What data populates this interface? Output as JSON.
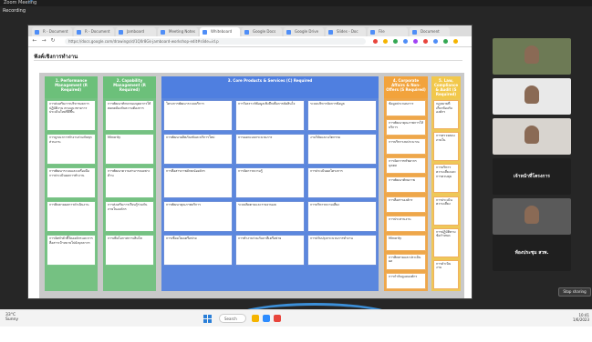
{
  "zoom": {
    "window_title": "Zoom Meeting",
    "subtitle": "Recording",
    "stop_sharing": "Stop sharing"
  },
  "browser": {
    "tabs": [
      "R - Document",
      "R - Document",
      "Jamboard",
      "Meeting Notes",
      "Whiteboard",
      "Google Docs",
      "Google Drive",
      "Slides - Doc",
      "File",
      "Document"
    ],
    "url": "https://docs.google.com/drawings/d/1Q0r8Gk-jamboard-workshop-edit#slide=id.p",
    "nav": [
      "←",
      "→",
      "↻"
    ]
  },
  "page": {
    "title": "ฟังค์เชิงการทำงาน"
  },
  "board": {
    "columns": [
      {
        "head": "1. Performance Management (R Required)",
        "color": "#6cc07a",
        "cards": [
          "การส่งเสริมการบริหารผลการปฏิบัติงาน ตามแนวทางการประเมินใหม่ที่ดีขึ้น",
          "การบูรณาการทำงานร่วมกันทุกส่วนงาน",
          "การพัฒนาระบบและเครื่องมือการประเมินผลการทำงาน",
          "การติดตามผลการดำเนินงาน",
          "การจัดทำตัวชี้วัดองค์กรและการสื่อสารเป้าหมายไปยังบุคลากร"
        ]
      },
      {
        "head": "2. Capability Management (R Required)",
        "color": "#6cc07a",
        "cards": [
          "การพัฒนาทักษะของบุคลากรให้สอดคล้องกับความต้องการ",
          "Minority",
          "การพัฒนาความสามารถเฉพาะด้าน",
          "การส่งเสริมการเรียนรู้ร่วมกันภายในองค์กร",
          "การเพิ่มโอกาสการเติบโต"
        ]
      },
      {
        "head": "3. Core Products & Services (C) Required",
        "color": "#4f7fe0",
        "cards": [
          "โครงการพัฒนาระบบบริการ",
          "การวิเคราะห์ข้อมูลเชิงลึกเพื่อการตัดสินใจ",
          "ระบบบริหารจัดการข้อมูล",
          "การพัฒนาผลิตภัณฑ์และบริการใหม่",
          "การออกแบบกระบวนการ",
          "งานวิจัยและนวัตกรรม",
          "การสื่อสารภาพลักษณ์องค์กร",
          "การจัดการความรู้",
          "การประเมินผลโครงการ",
          "การพัฒนาคุณภาพบริการ",
          "ระบบติดตามและรายงานผล",
          "การบริหารความเสี่ยง",
          "การเชื่อมโยงเครือข่าย",
          "การทำงานร่วมกับภาคีเครือข่าย",
          "การปรับปรุงกระบวนการทำงาน"
        ]
      },
      {
        "head": "4. Corporate Affairs & Non-Offers (S Required)",
        "color": "#f2a33c",
        "cards": [
          "ข้อมูลประกอบการ",
          "การพัฒนาคุณภาพการให้บริการ",
          "การบริหารงบประมาณ",
          "การจัดการทรัพยากรบุคคล",
          "การพัฒนาศักยภาพ",
          "การสื่อสารองค์กร",
          "การประสานงาน",
          "Minority",
          "การติดตามและประเมินผล",
          "การกำกับดูแลองค์กร"
        ]
      },
      {
        "head": "5. Law, Compliance & Audit (S Required)",
        "color": "#f2c84b",
        "cards": [
          "กฎหมายที่เกี่ยวข้องกับองค์กร",
          "การตรวจสอบภายใน",
          "การบริหารความเสี่ยงและการควบคุม",
          "การประเมินความเสี่ยง",
          "การปฏิบัติตามข้อกำหนด",
          "การดำเนินงาน"
        ]
      }
    ]
  },
  "participants": [
    {
      "name": "",
      "big": ""
    },
    {
      "name": "",
      "big": ""
    },
    {
      "name": "",
      "big": ""
    },
    {
      "name": "",
      "big": "เจ้าหน้าที่โครงการ"
    },
    {
      "name": "",
      "big": ""
    },
    {
      "name": "",
      "big": "ห้องประชุม สวพ."
    }
  ],
  "taskbar": {
    "weather_temp": "33°C",
    "weather_desc": "Sunny",
    "search": "Search",
    "time": "10:41",
    "date": "1/6/2023"
  }
}
